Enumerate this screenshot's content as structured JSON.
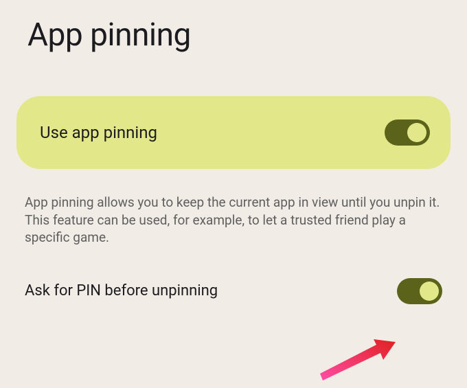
{
  "title": "App pinning",
  "primary_toggle": {
    "label": "Use app pinning",
    "state": "on"
  },
  "description": "App pinning allows you to keep the current app in view until you unpin it. This feature can be used, for example, to let a trusted friend play a specific game.",
  "secondary_toggle": {
    "label": "Ask for PIN before unpinning",
    "state": "on"
  }
}
